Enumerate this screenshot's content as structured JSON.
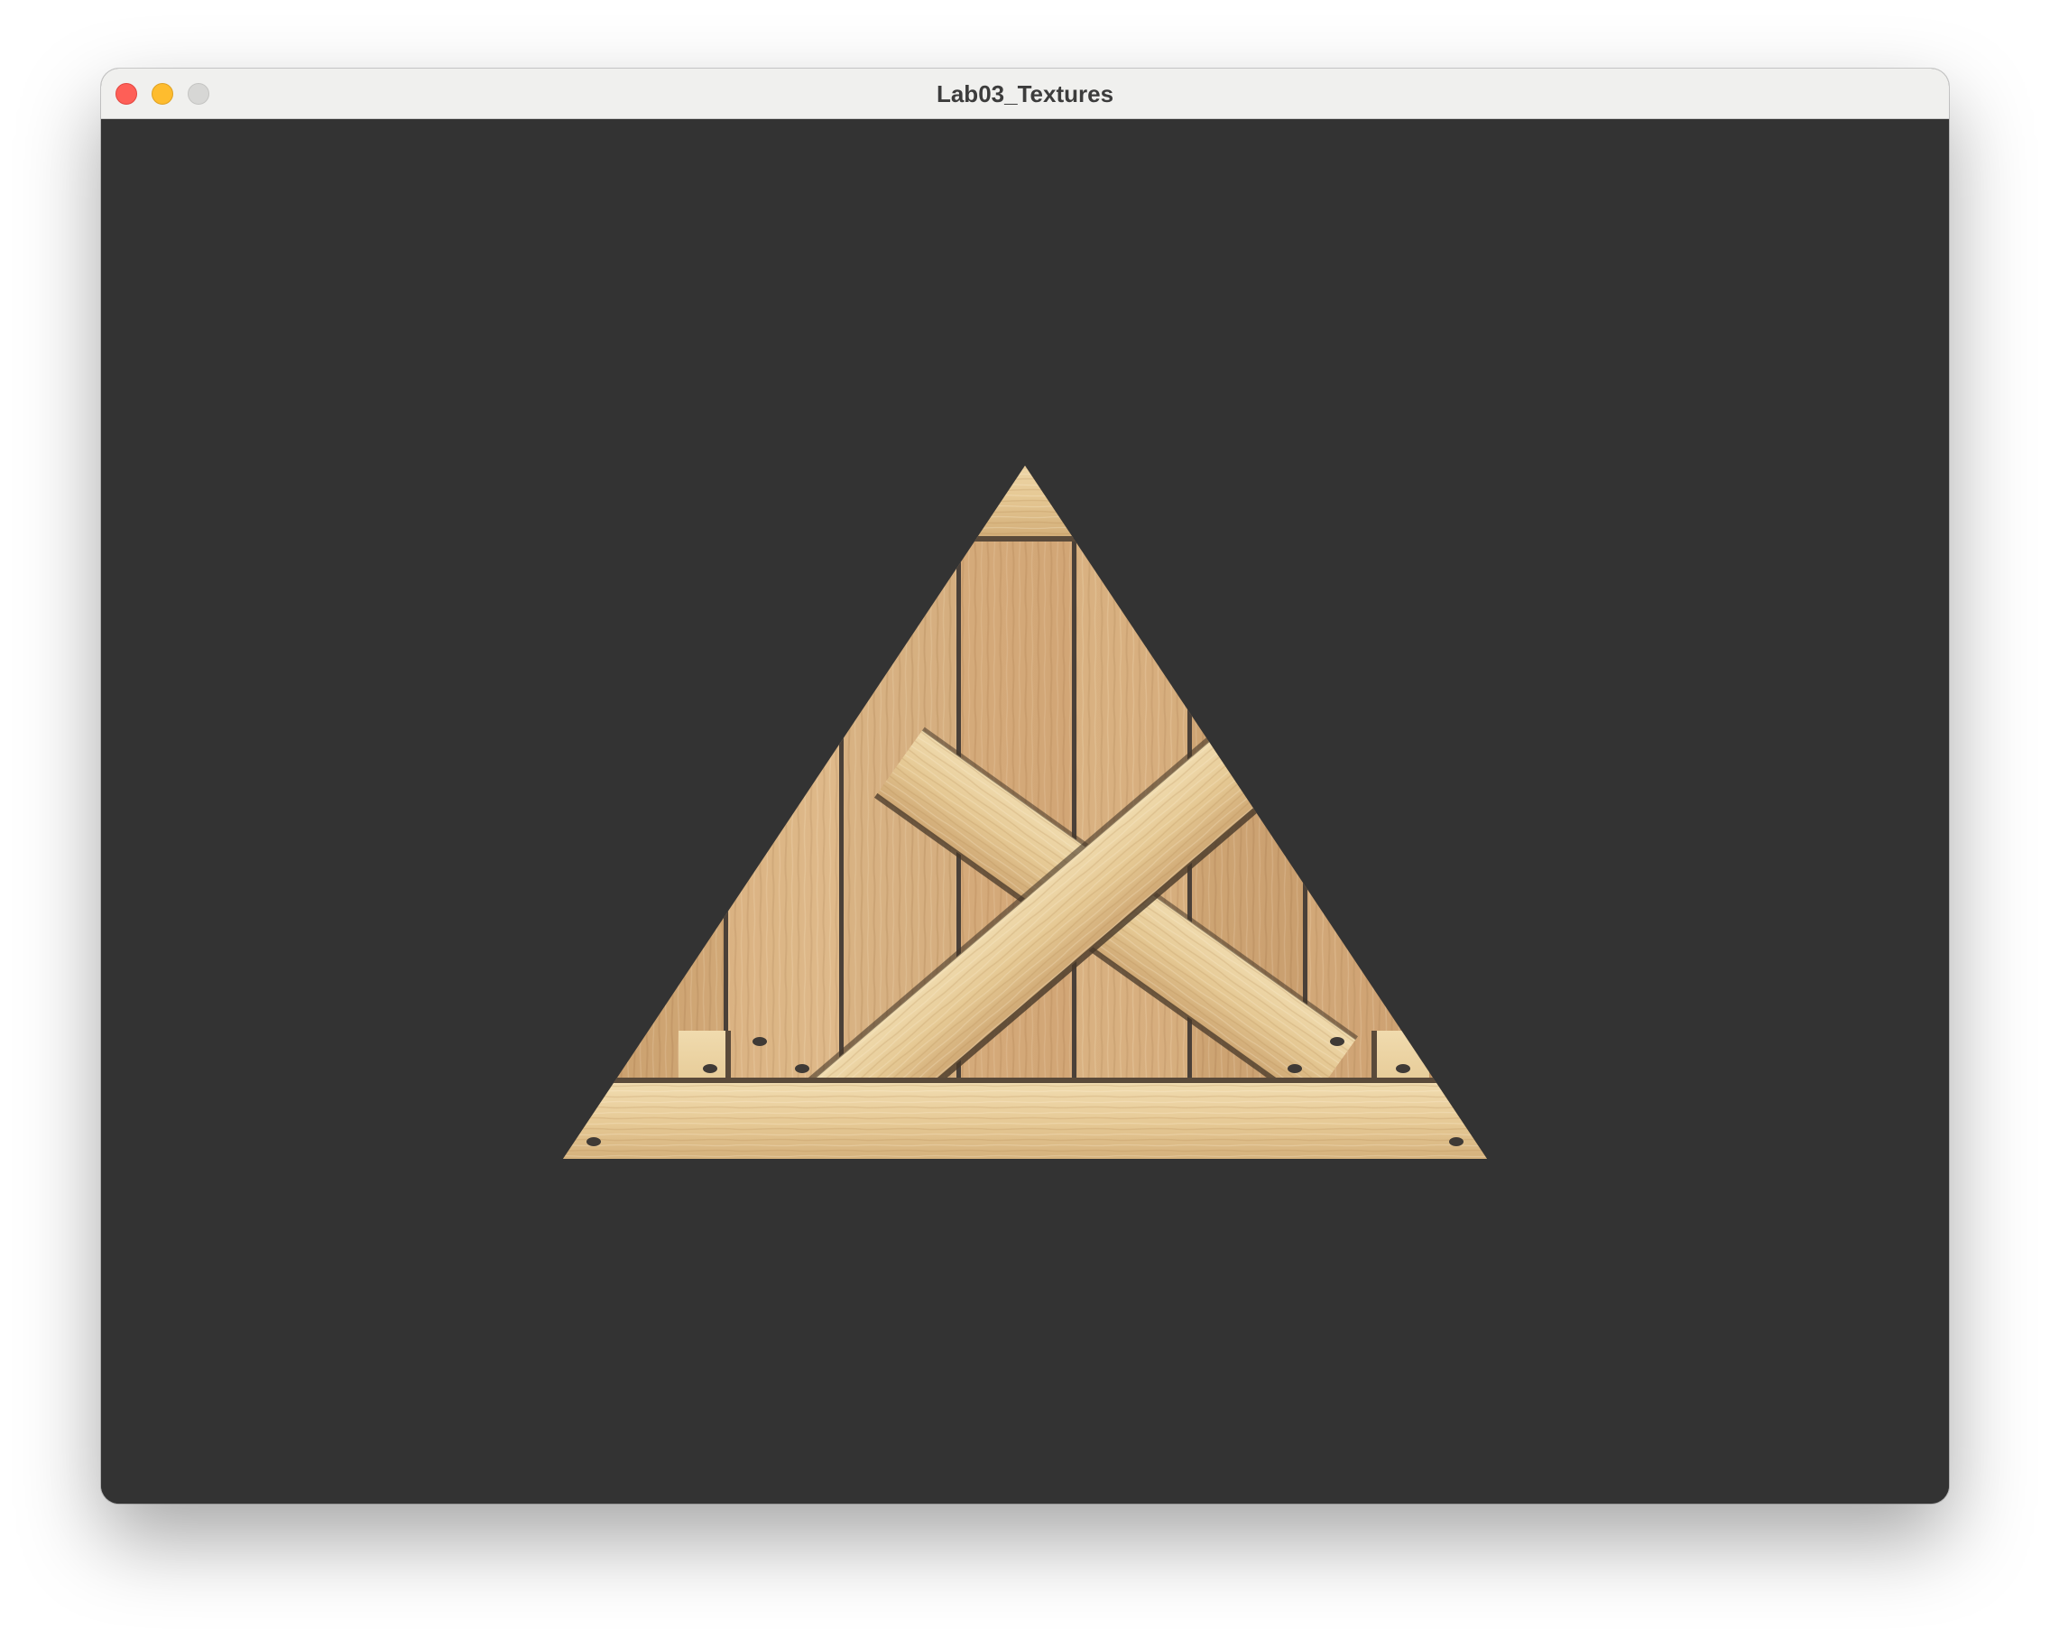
{
  "window": {
    "title": "Lab03_Textures",
    "buttons": {
      "close": "close-button",
      "minimize": "minimize-button",
      "zoom": "zoom-button"
    }
  },
  "viewport": {
    "clear_color": "#333333",
    "object": "textured-triangle",
    "texture": "wooden-crate",
    "colors": {
      "wood_light": "#e8cfa0",
      "wood_mid": "#d6b07d",
      "wood_dark": "#c19462",
      "groove": "#4a4038",
      "nail": "#3f3a36"
    }
  }
}
